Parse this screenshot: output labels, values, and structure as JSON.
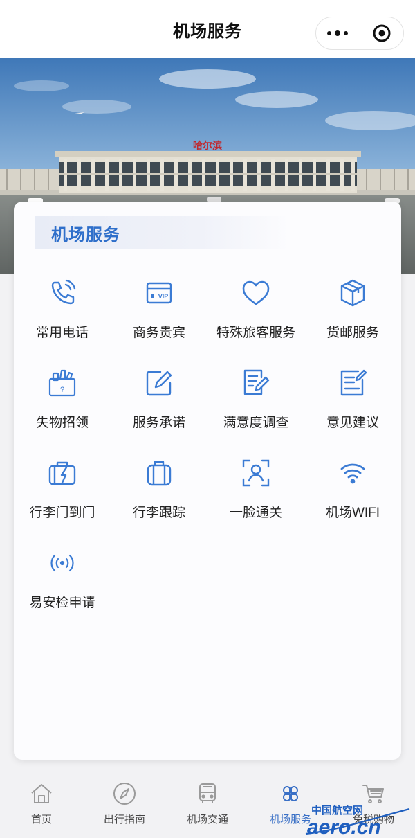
{
  "header": {
    "title": "机场服务",
    "more_icon": "more-dots-icon",
    "close_icon": "target-close-icon"
  },
  "banner": {
    "sign_text": "哈尔滨"
  },
  "card": {
    "title": "机场服务",
    "services": [
      {
        "label": "常用电话",
        "icon": "phone-icon"
      },
      {
        "label": "商务贵宾",
        "icon": "vip-card-icon",
        "badge": "VIP"
      },
      {
        "label": "特殊旅客服务",
        "icon": "heart-icon"
      },
      {
        "label": "货邮服务",
        "icon": "package-icon"
      },
      {
        "label": "失物招领",
        "icon": "lost-found-box-icon",
        "badge": "?"
      },
      {
        "label": "服务承诺",
        "icon": "edit-square-icon"
      },
      {
        "label": "满意度调查",
        "icon": "survey-document-icon"
      },
      {
        "label": "意见建议",
        "icon": "suggestion-note-icon"
      },
      {
        "label": "行李门到门",
        "icon": "luggage-delivery-icon"
      },
      {
        "label": "行李跟踪",
        "icon": "suitcase-icon"
      },
      {
        "label": "一脸通关",
        "icon": "face-scan-icon"
      },
      {
        "label": "机场WIFI",
        "icon": "wifi-icon"
      },
      {
        "label": "易安检申请",
        "icon": "signal-broadcast-icon"
      }
    ]
  },
  "tabbar": {
    "items": [
      {
        "label": "首页",
        "icon": "home-icon",
        "active": false
      },
      {
        "label": "出行指南",
        "icon": "compass-icon",
        "active": false
      },
      {
        "label": "机场交通",
        "icon": "bus-icon",
        "active": false
      },
      {
        "label": "机场服务",
        "icon": "clover-grid-icon",
        "active": true
      },
      {
        "label": "免税购物",
        "icon": "shopping-cart-icon",
        "active": false
      }
    ]
  },
  "watermark": {
    "line1": "中国航空网",
    "line2": "aero.cn"
  },
  "colors": {
    "accent": "#2f6fca",
    "tab_active": "#3a70c6",
    "icon_blue": "#3b7bd4"
  }
}
